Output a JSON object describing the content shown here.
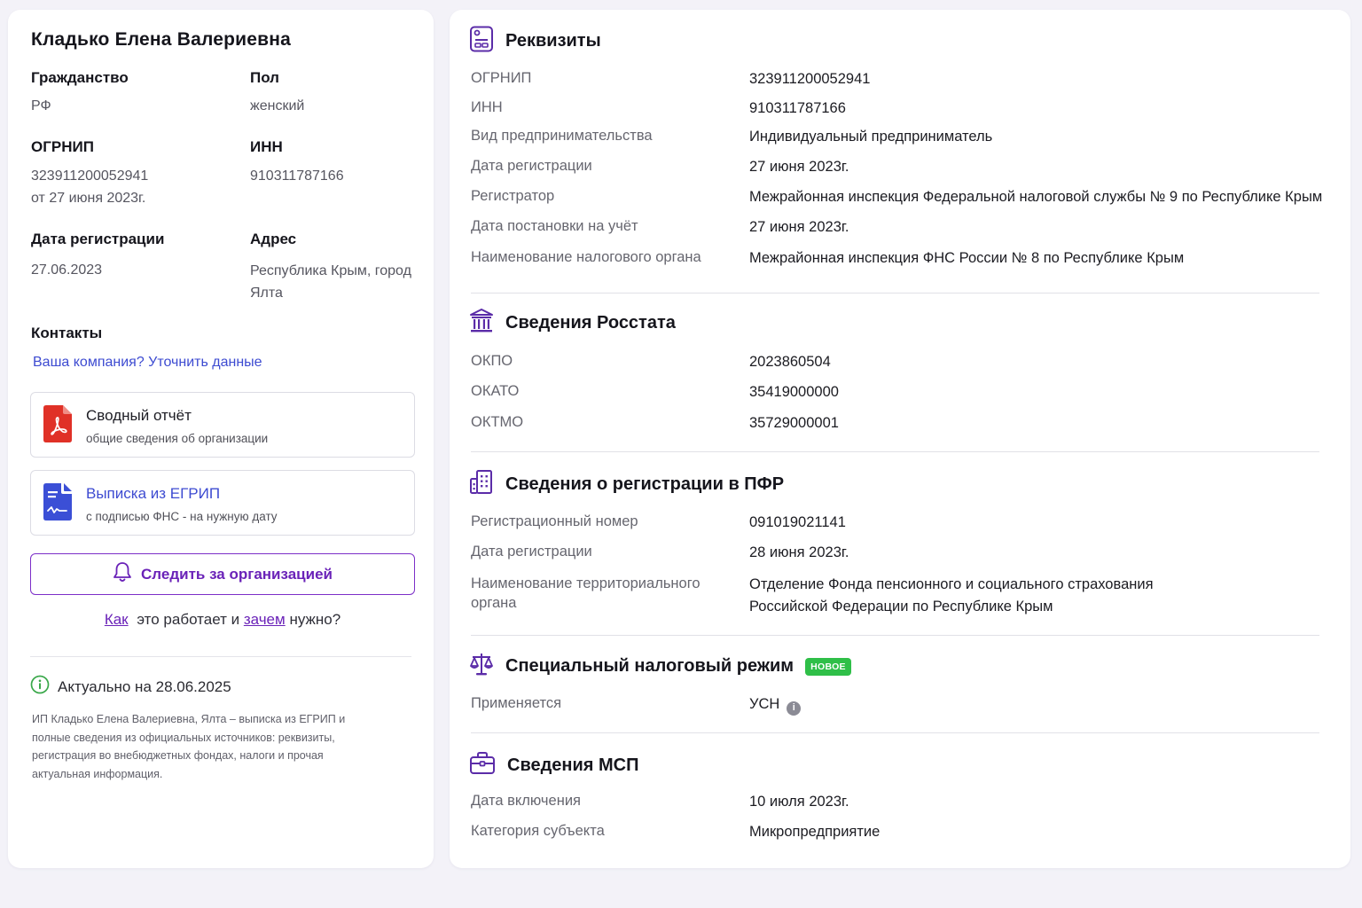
{
  "person": {
    "name": "Кладько Елена Валериевна",
    "citizenship_label": "Гражданство",
    "citizenship_value": "РФ",
    "gender_label": "Пол",
    "gender_value": "женский",
    "ogrnip_label": "ОГРНИП",
    "ogrnip_value": "323911200052941",
    "ogrnip_date": "от 27 июня 2023г.",
    "inn_label": "ИНН",
    "inn_value": "910311787166",
    "reg_date_label": "Дата регистрации",
    "reg_date_value": "27.06.2023",
    "address_label": "Адрес",
    "address_line1": "Республика Крым, город",
    "address_line2": "Ялта"
  },
  "contacts": {
    "title": "Контакты",
    "link": "Ваша компания? Уточнить данные"
  },
  "documents": [
    {
      "title": "Сводный отчёт",
      "subtitle": "общие сведения об организации",
      "icon": "pdf-icon"
    },
    {
      "title": "Выписка из ЕГРИП",
      "subtitle": "с подписью ФНС - на нужную дату",
      "icon": "signed-document-icon"
    }
  ],
  "follow": {
    "label": "Следить за организацией",
    "how_link": "Как",
    "how_mid": "это работает и",
    "why_link": "зачем",
    "why_end": "нужно?"
  },
  "actual": {
    "label": "Актуально на 28.06.2025",
    "description": "ИП Кладько Елена Валериевна, Ялта – выписка из ЕГРИП и полные сведения из официальных источников: реквизиты, регистрация во внебюджетных фондах, налоги и прочая актуальная информация."
  },
  "requisites": {
    "title": "Реквизиты",
    "rows": [
      {
        "label": "ОГРНИП",
        "value": "323911200052941"
      },
      {
        "label": "ИНН",
        "value": "910311787166"
      },
      {
        "label": "Вид предпринимательства",
        "value": "Индивидуальный предприниматель"
      },
      {
        "label": "Дата регистрации",
        "value": "27 июня 2023г."
      },
      {
        "label": "Регистратор",
        "value": "Межрайонная инспекция Федеральной налоговой службы № 9 по Республике Крым"
      },
      {
        "label": "Дата постановки на учёт",
        "value": "27 июня 2023г."
      },
      {
        "label": "Наименование налогового органа",
        "value": "Межрайонная инспекция ФНС России № 8 по Республике Крым"
      }
    ]
  },
  "rosstat": {
    "title": "Сведения Росстата",
    "rows": [
      {
        "label": "ОКПО",
        "value": "2023860504"
      },
      {
        "label": "ОКАТО",
        "value": "35419000000"
      },
      {
        "label": "ОКТМО",
        "value": "35729000001"
      }
    ]
  },
  "pfr": {
    "title": "Сведения о регистрации в ПФР",
    "rows": [
      {
        "label": "Регистрационный номер",
        "value": "091019021141"
      },
      {
        "label": "Дата регистрации",
        "value": "28 июня 2023г."
      }
    ],
    "org_label_line1": "Наименование территориального",
    "org_label_line2": "органа",
    "org_value_line1": "Отделение Фонда пенсионного и социального страхования",
    "org_value_line2": "Российской Федерации по Республике Крым"
  },
  "tax": {
    "title": "Специальный налоговый режим",
    "badge": "НОВОЕ",
    "label": "Применяется",
    "value": "УСН",
    "info": "i"
  },
  "msp": {
    "title": "Сведения МСП",
    "rows": [
      {
        "label": "Дата включения",
        "value": "10 июля 2023г."
      },
      {
        "label": "Категория субъекта",
        "value": "Микропредприятие"
      }
    ]
  },
  "colors": {
    "accent": "#6a22b8",
    "link": "#3d4bd1",
    "section_icon": "#5b2ca8",
    "badge_green": "#2fbf48",
    "pdf_red": "#e03127",
    "doc_blue": "#3b4fd6"
  }
}
